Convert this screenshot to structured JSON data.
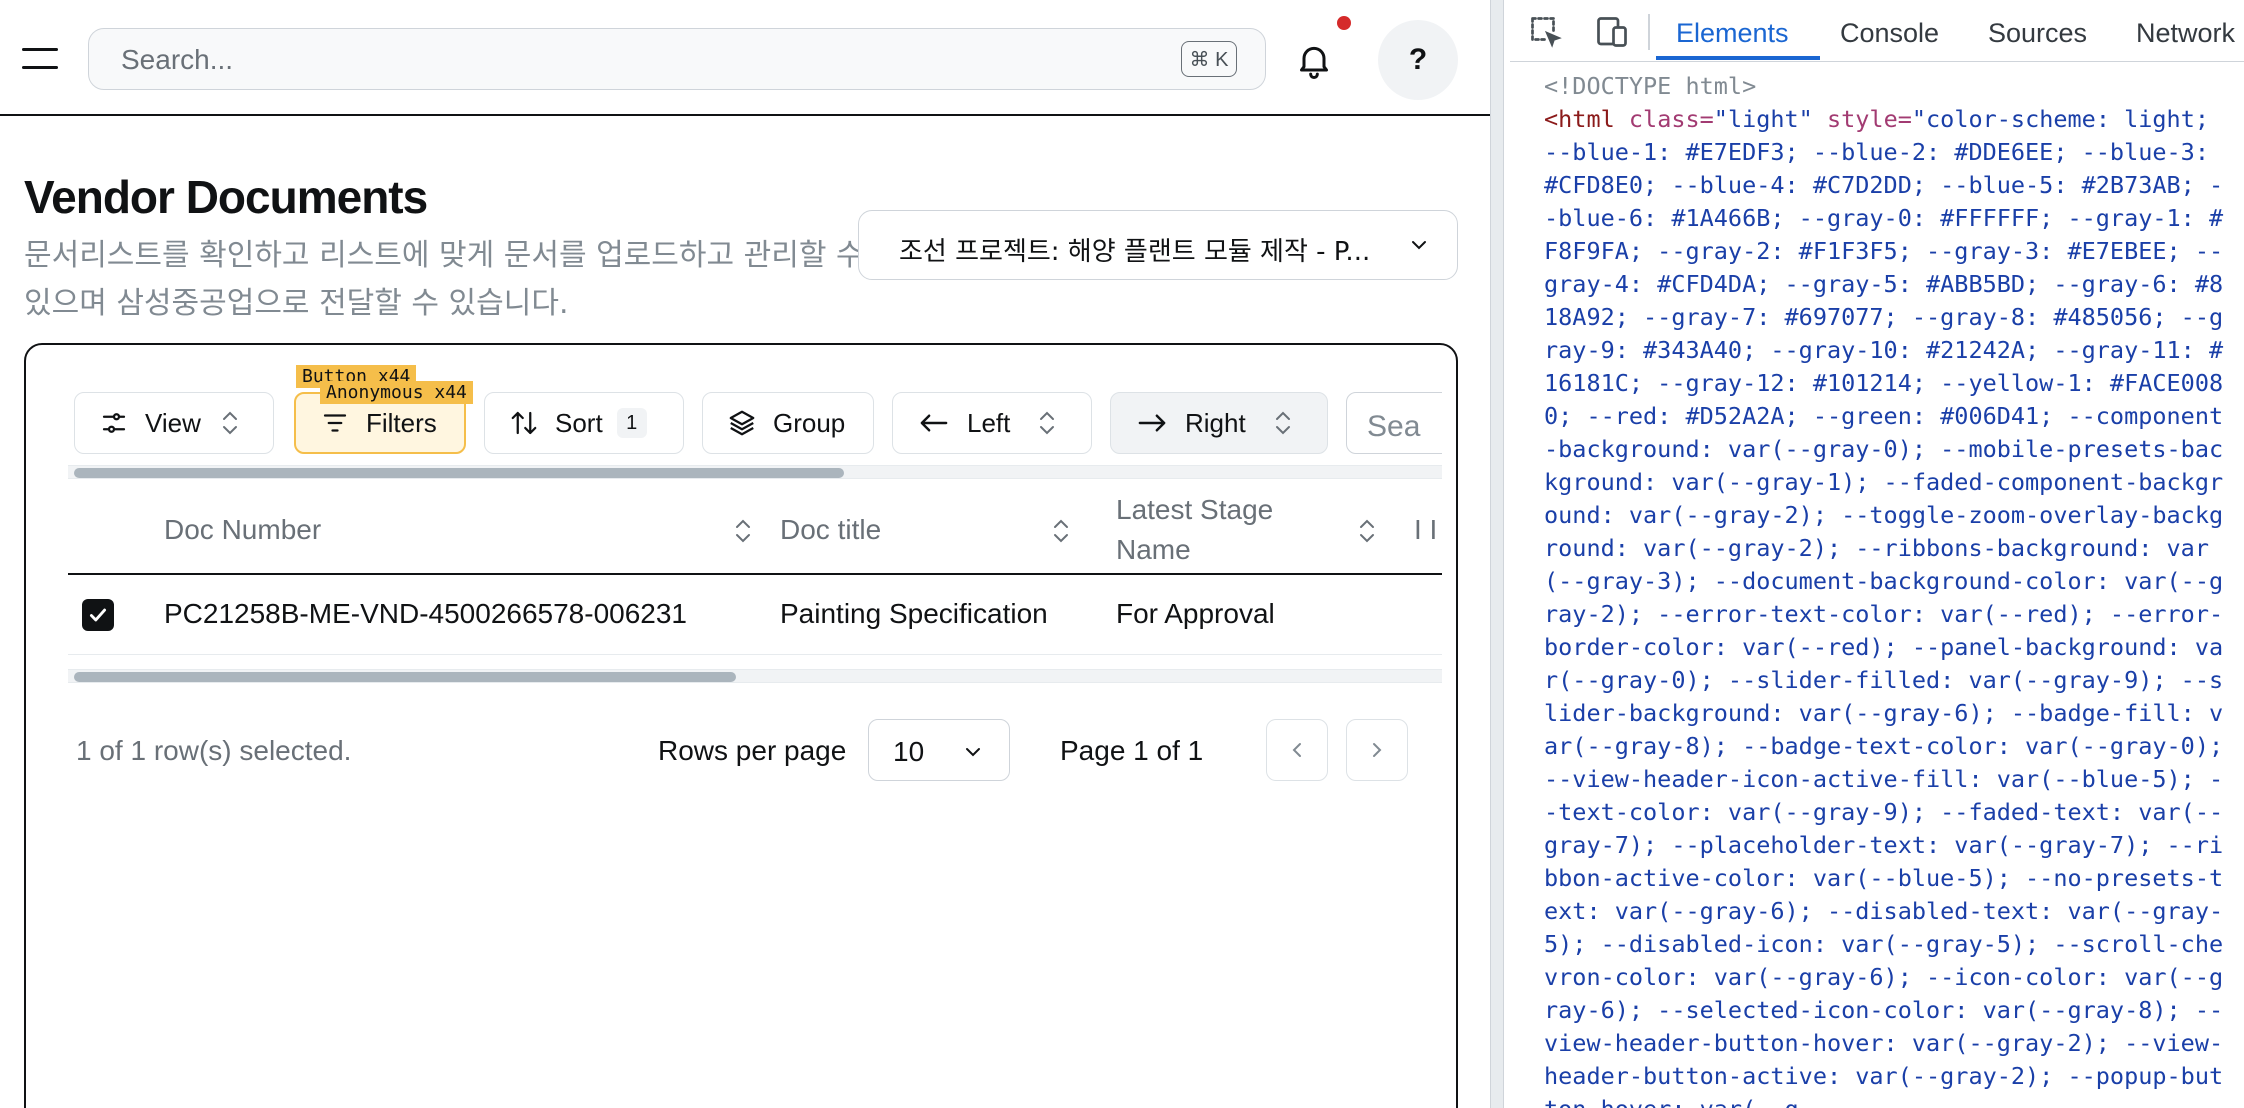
{
  "topbar": {
    "search_placeholder": "Search...",
    "shortcut": "⌘ K",
    "help_label": "?"
  },
  "page": {
    "title": "Vendor Documents",
    "subtitle": "문서리스트를 확인하고 리스트에 맞게 문서를 업로드하고 관리할 수 있으며 삼성중공업으로 전달할 수 있습니다.",
    "project_select": "조선 프로젝트: 해양 플랜트 모듈 제작 - P..."
  },
  "toolbar": {
    "view": "View",
    "filters": "Filters",
    "sort": "Sort",
    "sort_count": "1",
    "group": "Group",
    "left": "Left",
    "right": "Right",
    "search_placeholder": "Sea",
    "overlay_tag_1": "Button x44",
    "overlay_tag_2": "Anonymous x44"
  },
  "table": {
    "columns": [
      {
        "label": "Doc Number"
      },
      {
        "label": "Doc title"
      },
      {
        "label": "Latest Stage Name"
      },
      {
        "label": "I I"
      }
    ],
    "rows": [
      {
        "selected": true,
        "doc_number": "PC21258B-ME-VND-4500266578-006231",
        "doc_title": "Painting Specification",
        "latest_stage": "For Approval"
      }
    ]
  },
  "footer": {
    "selection_text": "1 of 1 row(s) selected.",
    "rows_per_page_label": "Rows per page",
    "rows_per_page_value": "10",
    "page_label": "Page 1 of 1"
  },
  "devtools": {
    "tabs": [
      "Elements",
      "Console",
      "Sources",
      "Network"
    ],
    "active_tab": "Elements",
    "doctype": "<!DOCTYPE html>",
    "html_open_tag": "<html",
    "class_attr": " class=",
    "class_value": "\"light\"",
    "style_attr": " style=",
    "style_value": "\"color-scheme: light; --blue-1: #E7EDF3; --blue-2: #DDE6EE; --blue-3: #CFD8E0; --blue-4: #C7D2DD; --blue-5: #2B73AB; --blue-6: #1A466B; --gray-0: #FFFFFF; --gray-1: #F8F9FA; --gray-2: #F1F3F5; --gray-3: #E7EBEE; --gray-4: #CFD4DA; --gray-5: #ABB5BD; --gray-6: #818A92; --gray-7: #697077; --gray-8: #485056; --gray-9: #343A40; --gray-10: #21242A; --gray-11: #16181C; --gray-12: #101214; --yellow-1: #FACE0080; --red: #D52A2A; --green: #006D41; --component-background: var(--gray-0); --mobile-presets-background: var(--gray-1); --faded-component-background: var(--gray-2); --toggle-zoom-overlay-background: var(--gray-2); --ribbons-background: var(--gray-3); --document-background-color: var(--gray-2); --error-text-color: var(--red); --error-border-color: var(--red); --panel-background: var(--gray-0); --slider-filled: var(--gray-9); --slider-background: var(--gray-6); --badge-fill: var(--gray-8); --badge-text-color: var(--gray-0); --view-header-icon-active-fill: var(--blue-5); --text-color: var(--gray-9); --faded-text: var(--gray-7); --placeholder-text: var(--gray-7); --ribbon-active-color: var(--blue-5); --no-presets-text: var(--gray-6); --disabled-text: var(--gray-5); --disabled-icon: var(--gray-5); --scroll-chevron-color: var(--gray-6); --icon-color: var(--gray-6); --selected-icon-color: var(--gray-8); --view-header-button-hover: var(--gray-2); --view-header-button-active: var(--gray-2); --popup-button-hover: var(--g"
  },
  "colors": {
    "accent_blue": "#1A66D2",
    "notification_dot": "#D52A2A",
    "highlight_tag": "#F5BE4A",
    "text": "#101214",
    "faded_text": "#697077"
  }
}
